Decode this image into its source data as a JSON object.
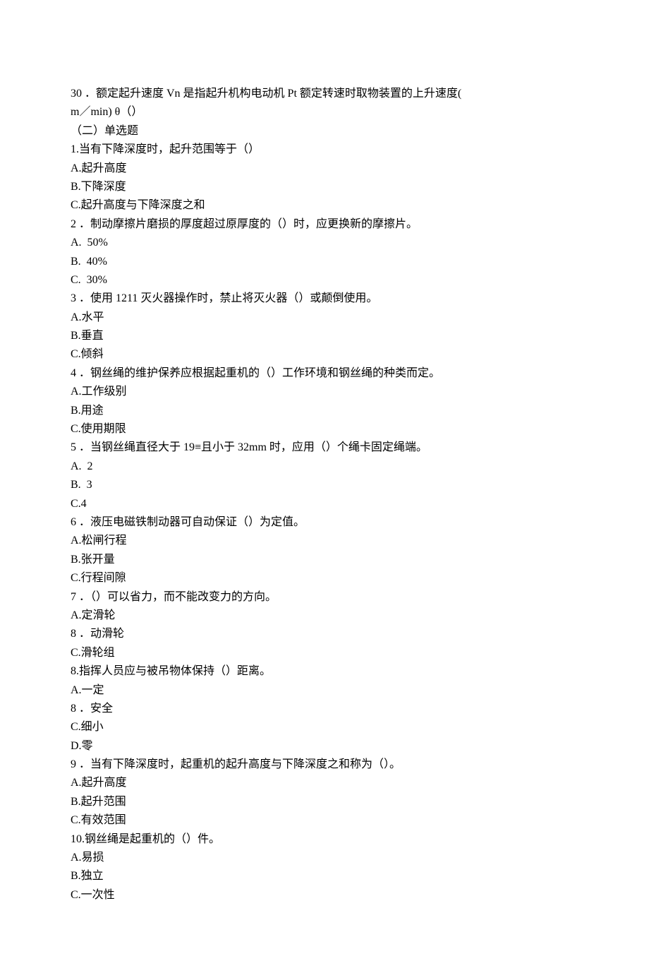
{
  "lines": [
    "30 ．额定起升速度 Vn 是指起升机构电动机 Pt 额定转速时取物装置的上升速度(",
    "m／min) θ（）",
    "（二）单选题",
    "1.当有下降深度时，起升范围等于（）",
    "A.起升高度",
    "B.下降深度",
    "C.起升高度与下降深度之和",
    "2 ．制动摩擦片磨损的厚度超过原厚度的（）时，应更换新的摩擦片。",
    "A.  50%",
    "B.  40%",
    "C.  30%",
    "3 ．使用 1211 灭火器操作时，禁止将灭火器（）或颠倒使用。",
    "A.水平",
    "B.垂直",
    "C.倾斜",
    "4 ．钢丝绳的维护保养应根据起重机的（）工作环境和钢丝绳的种类而定。",
    "A.工作级别",
    "B.用途",
    "C.使用期限",
    "5 ．当钢丝绳直径大于 19≡且小于 32mm 时，应用（）个绳卡固定绳端。",
    "A.  2",
    "B.  3",
    "C.4",
    "6 ．液压电磁铁制动器可自动保证（）为定值。",
    "A.松闸行程",
    "B.张开量",
    "C.行程间隙",
    "7 ．（）可以省力，而不能改变力的方向。",
    "A.定滑轮",
    "8 ．动滑轮",
    "C.滑轮组",
    "8.指挥人员应与被吊物体保持（）距离。",
    "A.一定",
    "8 ．安全",
    "C.细小",
    "D.零",
    "9 ．当有下降深度时，起重机的起升高度与下降深度之和称为（）。",
    "A.起升高度",
    "B.起升范围",
    "C.有效范围",
    "10.钢丝绳是起重机的（）件。",
    "A.易损",
    "B.独立",
    "C.一次性"
  ]
}
